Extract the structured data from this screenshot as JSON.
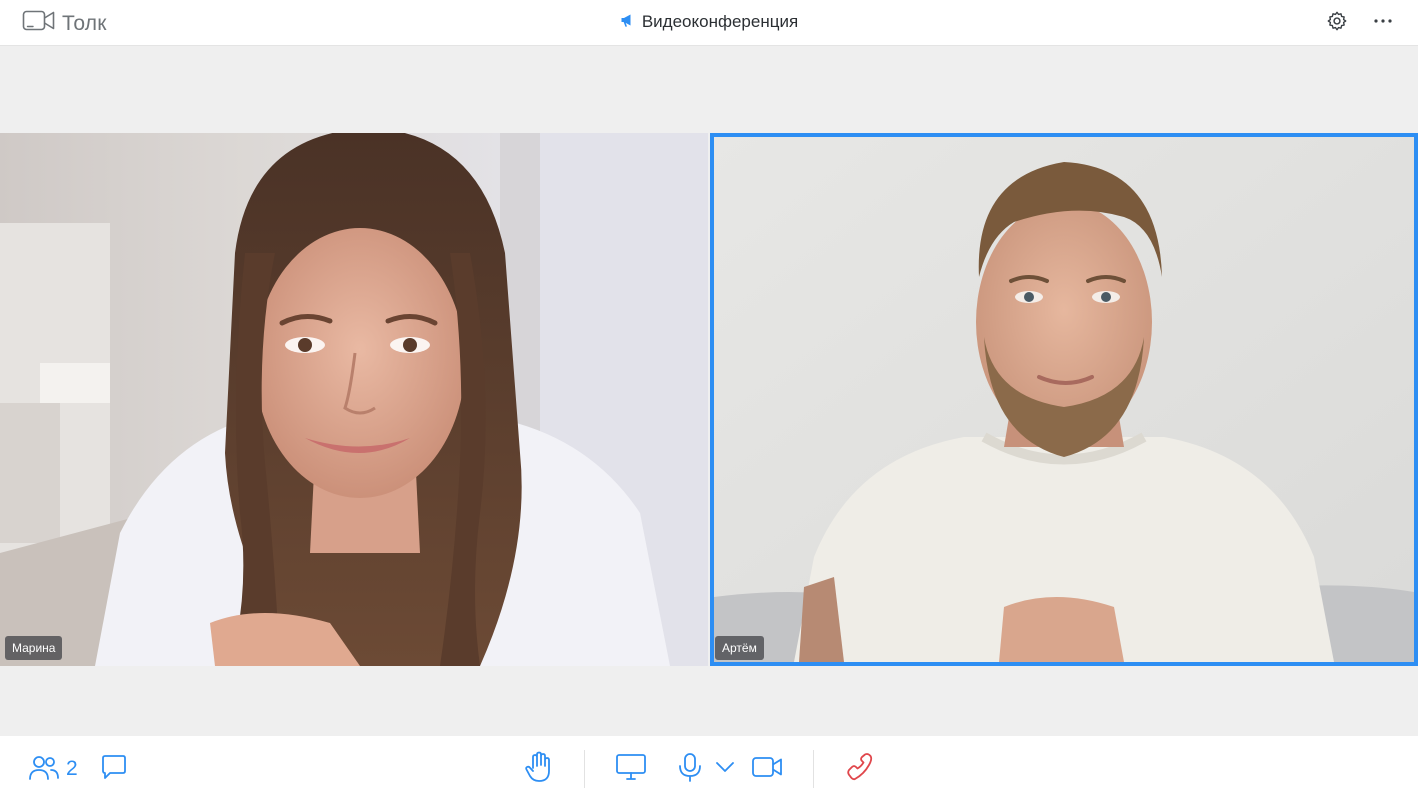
{
  "app": {
    "name": "Толк"
  },
  "header": {
    "title": "Видеоконференция"
  },
  "participants": [
    {
      "name": "Марина"
    },
    {
      "name": "Артём"
    }
  ],
  "toolbar": {
    "participant_count": "2"
  },
  "icons": {
    "logo": "camera-icon",
    "title": "megaphone-icon",
    "settings": "gear-icon",
    "more": "more-dots-icon",
    "participants": "people-icon",
    "chat": "chat-icon",
    "raise_hand": "hand-icon",
    "screen_share": "monitor-icon",
    "microphone": "microphone-icon",
    "mic_options": "chevron-down-icon",
    "camera": "video-camera-icon",
    "end_call": "phone-hangup-icon"
  },
  "colors": {
    "accent": "#2d8ef3",
    "end_call": "#e0474c",
    "active_speaker_border": "#2d8ef3",
    "background": "#efefef"
  }
}
